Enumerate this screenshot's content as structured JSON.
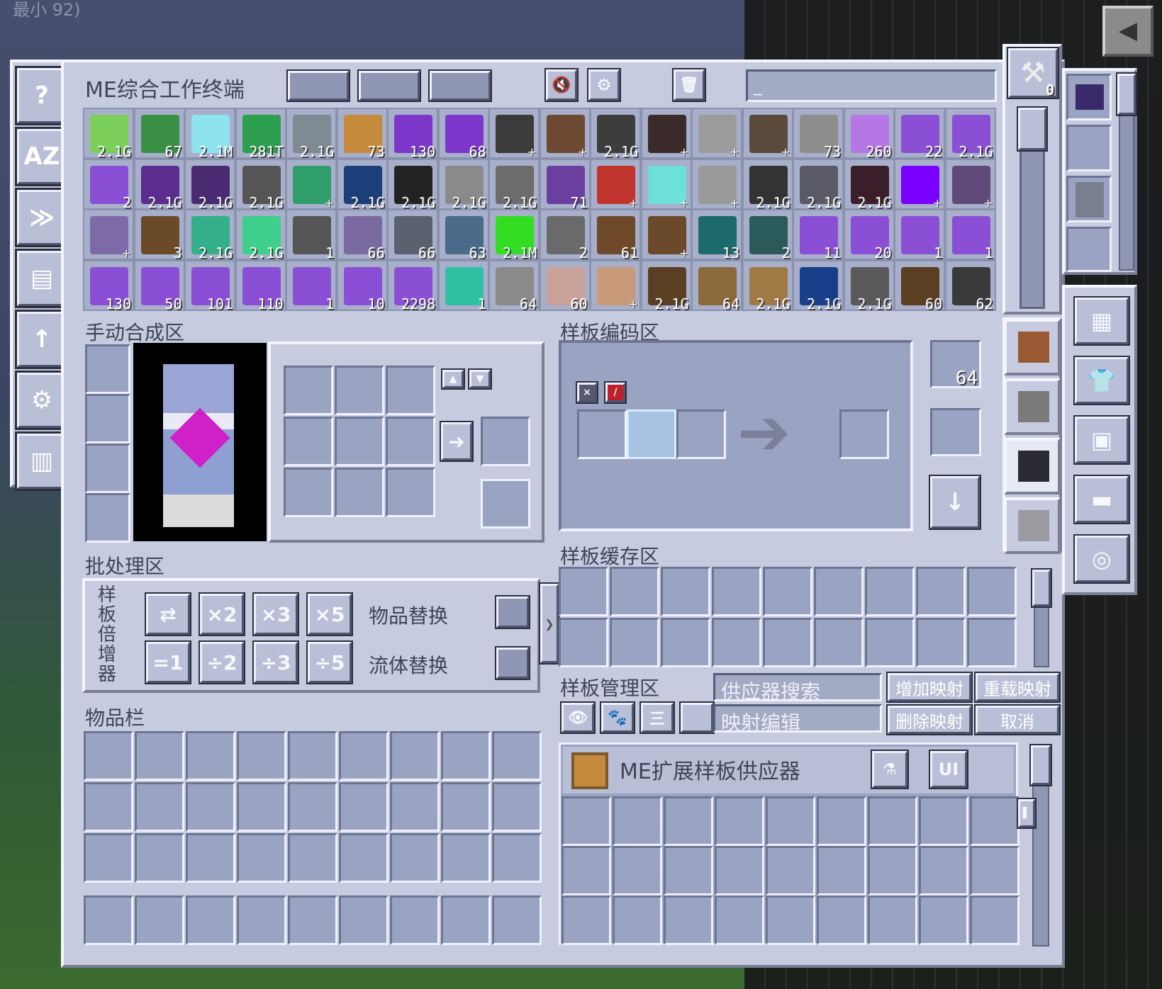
{
  "background": {
    "top_left_text": "最小 92)",
    "corner_button": "◀"
  },
  "terminal": {
    "title": "ME综合工作终端",
    "search_value": "_",
    "sidebar": [
      {
        "glyph": "?"
      },
      {
        "glyph": "AZ"
      },
      {
        "glyph": "≫"
      },
      {
        "glyph": "▤"
      },
      {
        "glyph": "↑"
      },
      {
        "glyph": "⚙"
      },
      {
        "glyph": "▥"
      }
    ],
    "toolbar": {
      "mute_glyph": "🔇",
      "settings_glyph": "⚙",
      "trash_glyph": "🗑"
    },
    "tool_slot_count": "0",
    "items": [
      {
        "color": "#7ccf5a",
        "count": "2.1G"
      },
      {
        "color": "#3a8f47",
        "count": "67"
      },
      {
        "color": "#8ee3ef",
        "count": "2.1M"
      },
      {
        "color": "#2e9e4f",
        "count": "281T"
      },
      {
        "color": "#808a92",
        "count": "2.1G"
      },
      {
        "color": "#c58a3b",
        "count": "73"
      },
      {
        "color": "#7c36c9",
        "count": "130"
      },
      {
        "color": "#7c36c9",
        "count": "68"
      },
      {
        "color": "#3b3b3b",
        "count": "+"
      },
      {
        "color": "#6e4a33",
        "count": "+"
      },
      {
        "color": "#3d3d3d",
        "count": "2.1G"
      },
      {
        "color": "#3a2a2a",
        "count": "+"
      },
      {
        "color": "#9c9c9c",
        "count": "+"
      },
      {
        "color": "#5c4b3d",
        "count": "+"
      },
      {
        "color": "#8d8d8d",
        "count": "73"
      },
      {
        "color": "#b577e6",
        "count": "260"
      },
      {
        "color": "#8b4fd6",
        "count": "22"
      },
      {
        "color": "#8b4fd6",
        "count": "2.1G"
      },
      {
        "color": "#8b4fd6",
        "count": "2"
      },
      {
        "color": "#5b2d8e",
        "count": "2.1G"
      },
      {
        "color": "#4a2a70",
        "count": "2.1G"
      },
      {
        "color": "#555555",
        "count": "2.1G"
      },
      {
        "color": "#2f9e6a",
        "count": "+"
      },
      {
        "color": "#1c3f7a",
        "count": "2.1G"
      },
      {
        "color": "#222222",
        "count": "2.1G"
      },
      {
        "color": "#8a8a8a",
        "count": "2.1G"
      },
      {
        "color": "#6c6c6c",
        "count": "2.1G"
      },
      {
        "color": "#6b3fa0",
        "count": "71"
      },
      {
        "color": "#c0352d",
        "count": "+"
      },
      {
        "color": "#6de0d8",
        "count": "+"
      },
      {
        "color": "#9a9a9a",
        "count": "+"
      },
      {
        "color": "#333333",
        "count": "2.1G"
      },
      {
        "color": "#5a5a66",
        "count": "2.1G"
      },
      {
        "color": "#3a1f2a",
        "count": "2.1G"
      },
      {
        "color": "#7a00ff",
        "count": "+"
      },
      {
        "color": "#5f4a7a",
        "count": "+"
      },
      {
        "color": "#7e6aa8",
        "count": "+"
      },
      {
        "color": "#6b4a2a",
        "count": "3"
      },
      {
        "color": "#33b08a",
        "count": "2.1G"
      },
      {
        "color": "#3ecf8a",
        "count": "2.1G"
      },
      {
        "color": "#555555",
        "count": "1"
      },
      {
        "color": "#7a6aa0",
        "count": "66"
      },
      {
        "color": "#5a6270",
        "count": "66"
      },
      {
        "color": "#4a6a8a",
        "count": "63"
      },
      {
        "color": "#33dd22",
        "count": "2.1M"
      },
      {
        "color": "#6a6a6a",
        "count": "2"
      },
      {
        "color": "#6e4a2a",
        "count": "61"
      },
      {
        "color": "#6a4a2a",
        "count": "+"
      },
      {
        "color": "#1d6a6a",
        "count": "13"
      },
      {
        "color": "#2a5a5a",
        "count": "2"
      },
      {
        "color": "#8b4fd6",
        "count": "11"
      },
      {
        "color": "#8b4fd6",
        "count": "20"
      },
      {
        "color": "#8b4fd6",
        "count": "1"
      },
      {
        "color": "#8b4fd6",
        "count": "1"
      },
      {
        "color": "#8b4fd6",
        "count": "130"
      },
      {
        "color": "#8b4fd6",
        "count": "50"
      },
      {
        "color": "#8b4fd6",
        "count": "101"
      },
      {
        "color": "#8b4fd6",
        "count": "110"
      },
      {
        "color": "#8b4fd6",
        "count": "1"
      },
      {
        "color": "#8b4fd6",
        "count": "10"
      },
      {
        "color": "#8b4fd6",
        "count": "2298"
      },
      {
        "color": "#2fbfa3",
        "count": "1"
      },
      {
        "color": "#8a8a8a",
        "count": "64"
      },
      {
        "color": "#c9a29a",
        "count": "60"
      },
      {
        "color": "#c89a7a",
        "count": "+"
      },
      {
        "color": "#5a3f22",
        "count": "2.1G"
      },
      {
        "color": "#8a6a3a",
        "count": "64"
      },
      {
        "color": "#a07a45",
        "count": "2.1G"
      },
      {
        "color": "#1a3f8a",
        "count": "2.1G"
      },
      {
        "color": "#5a5a5a",
        "count": "2.1G"
      },
      {
        "color": "#5a3f22",
        "count": "60"
      },
      {
        "color": "#3a3a3a",
        "count": "62"
      }
    ]
  },
  "crafting": {
    "title": "手动合成区",
    "up_glyph": "▲",
    "down_glyph": "▼",
    "craft_glyph": "➜"
  },
  "encoding": {
    "title": "样板编码区",
    "blank_pattern_count": "64",
    "encode_glyph": "↓",
    "arrow_glyph": "➔"
  },
  "batch": {
    "title": "批处理区",
    "multiplier_label": "样板倍增器",
    "buttons": [
      "⇄",
      "×2",
      "×3",
      "×5",
      "=1",
      "÷2",
      "÷3",
      "÷5"
    ],
    "item_replace": "物品替换",
    "fluid_replace": "流体替换"
  },
  "cache": {
    "title": "样板缓存区"
  },
  "manager": {
    "title": "样板管理区",
    "search_placeholder": "供应器搜索",
    "mapping_placeholder": "映射编辑",
    "add_mapping": "增加映射",
    "reload_mapping": "重载映射",
    "delete_mapping": "删除映射",
    "cancel": "取消",
    "icons": [
      "👁",
      "🐾",
      "三",
      ""
    ],
    "provider_name": "ME扩展样板供应器",
    "ui_button": "UI"
  },
  "inventory": {
    "title": "物品栏"
  },
  "right_tabs": [
    "▦",
    "👕",
    "▣",
    "▬",
    "◎"
  ]
}
